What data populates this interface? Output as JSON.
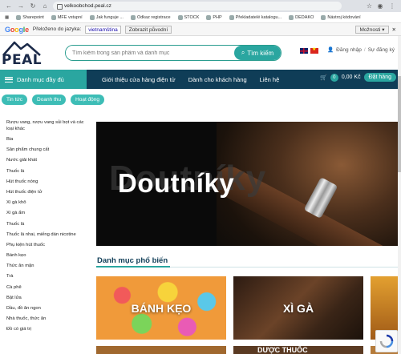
{
  "browser": {
    "url": "velkoobchod.peal.cz",
    "bookmarks": [
      "Sharepoint",
      "MFE vstupní",
      "Jak funguje ...",
      "Odkaz registrace",
      "STOCK",
      "PHP",
      "Překladatelé katalogu...",
      "DEDAKO",
      "Nástroj kódování"
    ]
  },
  "google_translate": {
    "logo_letters": [
      "G",
      "o",
      "o",
      "g",
      "l",
      "e"
    ],
    "label": "Přeloženo do jazyka:",
    "language": "vietnamština",
    "show_original": "Zobrazit původní",
    "options": "Možnosti ▾"
  },
  "header": {
    "logo_text": "PEAL",
    "search_placeholder": "Tìm kiếm trong sản phẩm và danh mục",
    "search_button": "Tìm kiếm",
    "login": "Đăng nhập",
    "separator": "/",
    "register": "Sự đăng ký"
  },
  "nav": {
    "categories_button": "Danh mục đầy đủ",
    "links": [
      "Giới thiệu cửa hàng điện tử",
      "Dành cho khách hàng",
      "Liên hệ"
    ],
    "cart_count": "0",
    "cart_total": "0,00 Kč",
    "order_button": "Đặt hàng"
  },
  "pills": [
    "Tin tức",
    "Doanh thu",
    "Hoạt động"
  ],
  "sidebar": [
    "Rượu vang, rượu vang sủi bọt và các loại khác",
    "Bia",
    "Sản phẩm chung cất",
    "Nước giải khát",
    "Thuốc lá",
    "Hút thuốc nóng",
    "Hút thuốc điện tử",
    "Xì gà khô",
    "Xì gà ẩm",
    "Thuốc lá",
    "Thuốc lá nhai, miếng dán nicotine",
    "Phụ kiện hút thuốc",
    "Bánh kẹo",
    "Thức ăn mặn",
    "Trà",
    "Cà phê",
    "Bật lửa",
    "Dầu, đồ ăn ngon",
    "Nhà thuốc, thức ăn",
    "Đồ có giá trị"
  ],
  "banner": {
    "title": "Doutníky"
  },
  "popular": {
    "title": "Danh mục phổ biến",
    "cards": [
      "BÁNH KẸO",
      "XÌ GÀ"
    ],
    "row2_partial": "DƯỢC THUỐC"
  }
}
